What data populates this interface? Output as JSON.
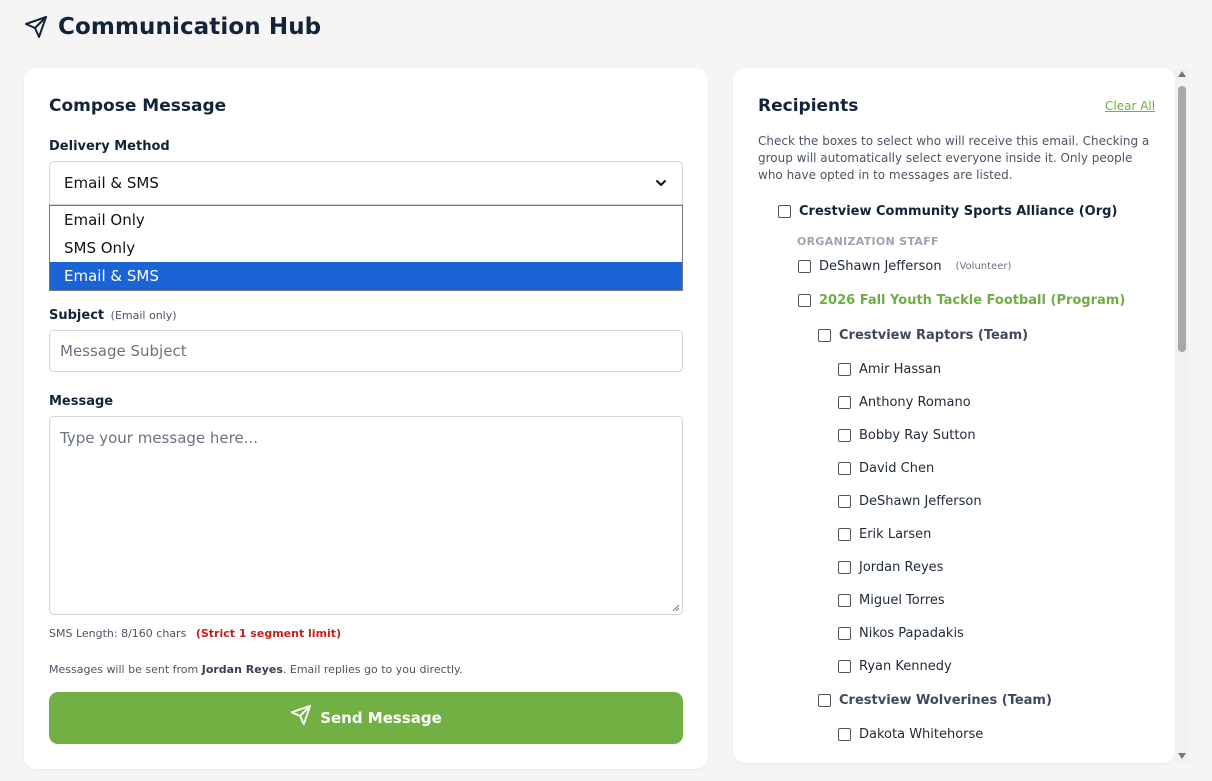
{
  "page": {
    "title": "Communication Hub"
  },
  "compose": {
    "title": "Compose Message",
    "delivery_label": "Delivery Method",
    "delivery_value": "Email & SMS",
    "delivery_options": [
      "Email Only",
      "SMS Only",
      "Email & SMS"
    ],
    "subject_label": "Subject",
    "subject_hint": "(Email only)",
    "subject_placeholder": "Message Subject",
    "message_label": "Message",
    "message_placeholder": "Type your message here...",
    "sms_length": "SMS Length: 8/160 chars",
    "sms_limit": "(Strict 1 segment limit)",
    "sender_prefix": "Messages will be sent from ",
    "sender_name": "Jordan Reyes",
    "sender_suffix": ". Email replies go to you directly.",
    "send_label": "Send Message"
  },
  "recipients": {
    "title": "Recipients",
    "clear_all": "Clear All",
    "description": "Check the boxes to select who will receive this email. Checking a group will automatically select everyone inside it. Only people who have opted in to messages are listed.",
    "org": "Crestview Community Sports Alliance (Org)",
    "staff_heading": "ORGANIZATION STAFF",
    "staff": [
      {
        "name": "DeShawn Jefferson",
        "role": "(Volunteer)"
      }
    ],
    "program": "2026 Fall Youth Tackle Football (Program)",
    "teams": [
      {
        "name": "Crestview Raptors (Team)",
        "members": [
          "Amir Hassan",
          "Anthony Romano",
          "Bobby Ray Sutton",
          "David Chen",
          "DeShawn Jefferson",
          "Erik Larsen",
          "Jordan Reyes",
          "Miguel Torres",
          "Nikos Papadakis",
          "Ryan Kennedy"
        ]
      },
      {
        "name": "Crestview Wolverines (Team)",
        "members": [
          "Dakota Whitehorse"
        ]
      }
    ]
  },
  "colors": {
    "accent_green": "#72b043",
    "selected_blue": "#1a64d6",
    "warning_red": "#c81e1e"
  }
}
